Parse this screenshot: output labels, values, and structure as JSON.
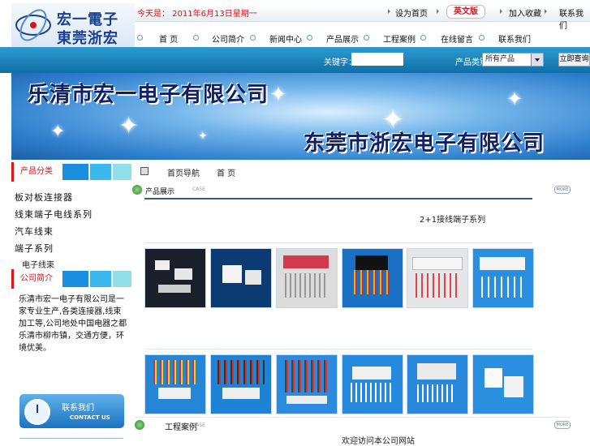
{
  "logo": {
    "line1": "宏一電子",
    "line2": "東莞浙宏"
  },
  "topbar": {
    "date": "今天是： 2011年6月13日星期一",
    "links": [
      "设为首页",
      "英文版",
      "加入收藏",
      "联系我们"
    ]
  },
  "nav": {
    "items": [
      "首 页",
      "公司简介",
      "新闻中心",
      "产品展示",
      "工程案例",
      "在线留言",
      "联系我们"
    ]
  },
  "search": {
    "label": "关键字：",
    "select_label": "产品类别：",
    "select_value": "所有产品",
    "button": "立即查询"
  },
  "banner": {
    "title1": "乐清市宏一电子有限公司",
    "title2": "东莞市浙宏电子有限公司"
  },
  "sidebar": {
    "section1": "产品分类",
    "links": [
      "板对板连接器",
      "线束端子电线系列",
      "汽车线束",
      "端子系列"
    ],
    "sublink": "电子线束",
    "section2": "公司简介",
    "intro": "乐清市宏一电子有限公司是一家专业生产,各类连接器,线束加工等,公司地处中国电器之都乐清市柳市镇，交通方便，环境优美。",
    "contact_cn": "联系我们",
    "contact_en": "CONTACT US"
  },
  "main": {
    "crumb_label": "首页导航",
    "crumb_current": "首 页",
    "section1_title": "产品展示",
    "section1_case": "CASE",
    "product_caption": "2+1接线端子系列",
    "section2_title": "工程案例",
    "section2_case": "CASE",
    "more": "MORE",
    "footer_caption": "欢迎访问本公司网站"
  },
  "colors": {
    "accent": "#d4151b",
    "brand_blue": "#1a73c3",
    "bar_blue": "#2d9bd0"
  }
}
